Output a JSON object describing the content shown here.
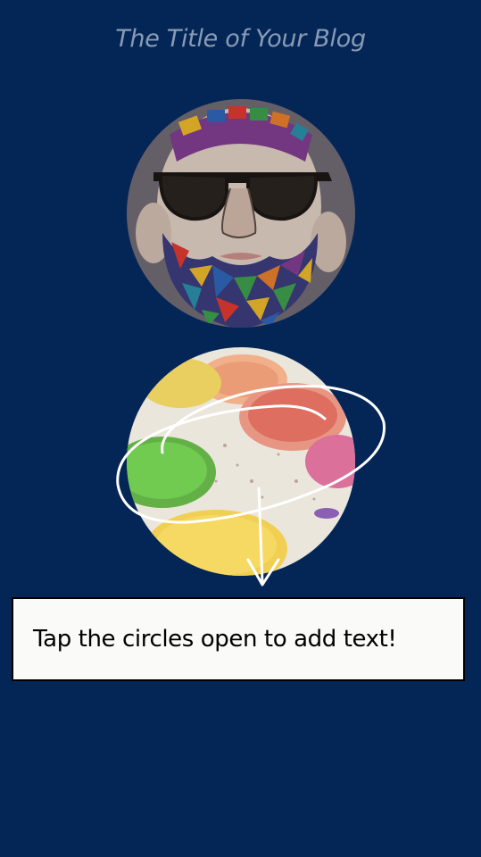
{
  "header": {
    "blog_title": "The Title of Your Blog"
  },
  "circles": [
    {
      "name": "avatar-circle",
      "image": "bearded-man-illustration",
      "state": "closed"
    },
    {
      "name": "paint-circle",
      "image": "watercolor-paint-palette",
      "state": "closed"
    }
  ],
  "hint": {
    "text": "Tap the circles open to add text!"
  },
  "colors": {
    "background": "#032657",
    "title": "#8a9bb4",
    "hint_box": "#fafbf8",
    "hint_border": "#000000",
    "scribble": "#ffffff"
  }
}
